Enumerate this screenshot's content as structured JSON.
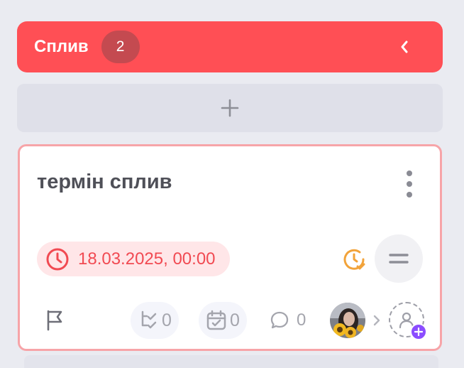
{
  "column": {
    "title": "Сплив",
    "count": "2",
    "color": "#ff4f55",
    "collapse_icon": "chevron-left-icon",
    "add_icon": "plus-icon"
  },
  "card": {
    "title": "термін сплив",
    "deadline": "18.03.2025, 00:00",
    "deadline_color": "#f14a52",
    "checklist_count": "0",
    "subtasks_count": "0",
    "comments_count": "0",
    "priority_icon": "equals-icon",
    "time_icon": "clock-icon",
    "border_color": "#f7a4a8"
  }
}
